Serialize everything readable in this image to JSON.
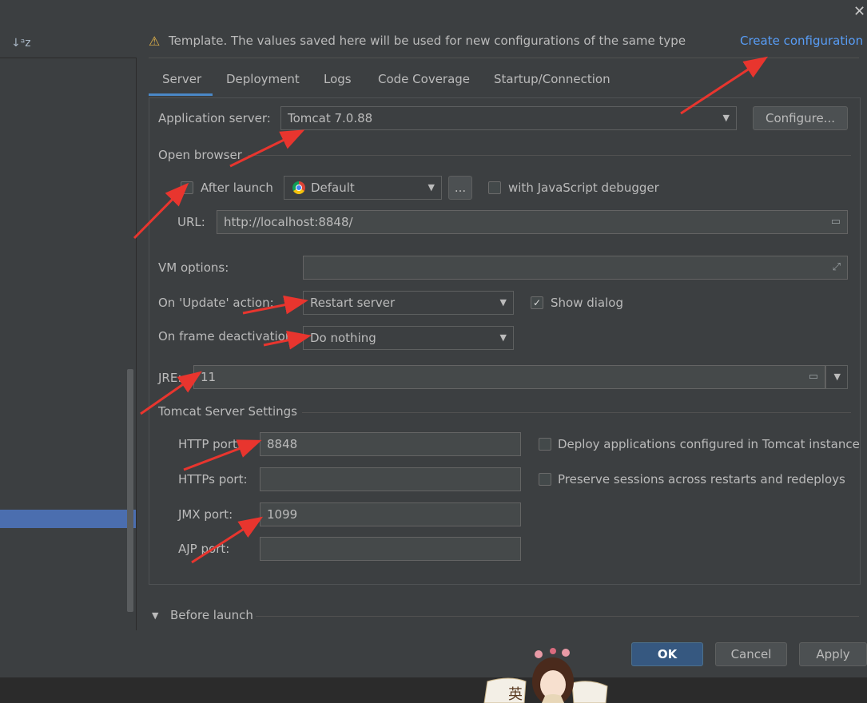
{
  "window": {
    "close_glyph": "✕"
  },
  "left_panel": {
    "sort_glyph": "↓ᵃz"
  },
  "template": {
    "warning_glyph": "⚠",
    "text": "Template. The values saved here will be used for new configurations of the same type",
    "create_link": "Create configuration"
  },
  "tabs": [
    {
      "label": "Server"
    },
    {
      "label": "Deployment"
    },
    {
      "label": "Logs"
    },
    {
      "label": "Code Coverage"
    },
    {
      "label": "Startup/Connection"
    }
  ],
  "server": {
    "app_server_label": "Application server:",
    "app_server_value": "Tomcat 7.0.88",
    "configure_button": "Configure...",
    "open_browser_label": "Open browser",
    "after_launch_label": "After launch",
    "after_launch_checked": false,
    "browser_value": "Default",
    "browse_button": "...",
    "js_debugger_label": "with JavaScript debugger",
    "js_debugger_checked": false,
    "url_label": "URL:",
    "url_value": "http://localhost:8848/",
    "vm_options_label": "VM options:",
    "vm_options_value": "",
    "update_action_label": "On 'Update' action:",
    "update_action_value": "Restart server",
    "show_dialog_label": "Show dialog",
    "show_dialog_checked": true,
    "frame_deactivation_label": "On frame deactivation:",
    "frame_deactivation_value": "Do nothing",
    "jre_label": "JRE:",
    "jre_value": "11",
    "tomcat_settings_label": "Tomcat Server Settings",
    "http_port_label": "HTTP port:",
    "http_port_value": "8848",
    "https_port_label": "HTTPs port:",
    "https_port_value": "",
    "jmx_port_label": "JMX port:",
    "jmx_port_value": "1099",
    "ajp_port_label": "AJP port:",
    "ajp_port_value": "",
    "deploy_apps_label": "Deploy applications configured in Tomcat instance",
    "deploy_apps_checked": false,
    "preserve_sessions_label": "Preserve sessions across restarts and redeploys",
    "preserve_sessions_checked": false
  },
  "before_launch": {
    "label": "Before launch"
  },
  "buttons": {
    "ok": "OK",
    "cancel": "Cancel",
    "apply": "Apply"
  },
  "mascot": {
    "text": "英"
  },
  "colors": {
    "accent": "#4a88c7",
    "link": "#589df6",
    "arrow": "#e8352e",
    "ok_button": "#365880"
  }
}
